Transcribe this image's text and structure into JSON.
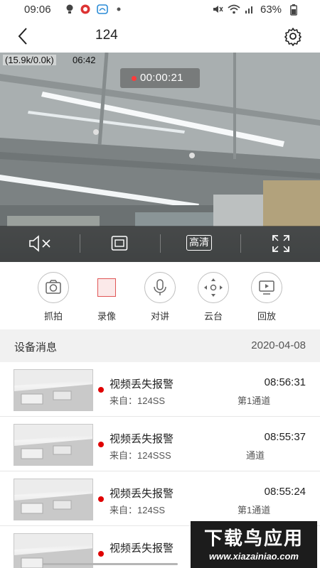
{
  "status_bar": {
    "time": "09:06",
    "battery": "63%",
    "icons": [
      "bulb-icon",
      "app-icon",
      "cloud-icon",
      "dot-icon",
      "mute-icon",
      "wifi-icon",
      "signal-icon",
      "battery-icon"
    ]
  },
  "nav": {
    "title": "124",
    "back_icon": "chevron-left-icon",
    "settings_icon": "gear-icon"
  },
  "video": {
    "stats": "(15.9k/0.0k)",
    "clock": "06:42",
    "record_timer": "00:00:21",
    "hd_label": "高清",
    "controls": [
      "mute-icon",
      "screen-icon",
      "hd-button",
      "fullscreen-icon"
    ]
  },
  "actions": [
    {
      "label": "抓拍",
      "icon": "camera-icon"
    },
    {
      "label": "录像",
      "icon": "record-icon"
    },
    {
      "label": "对讲",
      "icon": "microphone-icon"
    },
    {
      "label": "云台",
      "icon": "ptz-icon"
    },
    {
      "label": "回放",
      "icon": "playback-icon"
    }
  ],
  "messages": {
    "header_title": "设备消息",
    "header_date": "2020-04-08",
    "items": [
      {
        "title": "视频丢失报警",
        "time": "08:56:31",
        "from": "来自：124SS",
        "channel": "第1通道"
      },
      {
        "title": "视频丢失报警",
        "time": "08:55:37",
        "from": "来自：124SSS",
        "channel": "通道"
      },
      {
        "title": "视频丢失报警",
        "time": "08:55:24",
        "from": "来自：124SS",
        "channel": "第1通道"
      },
      {
        "title": "视频丢失报警",
        "time": "",
        "from": "",
        "channel": ""
      }
    ]
  },
  "watermark": {
    "line1": "下载鸟应用",
    "line2": "www.xiazainiao.com"
  },
  "colors": {
    "record_red": "#e00000",
    "accent_border": "#bfbfbf"
  }
}
